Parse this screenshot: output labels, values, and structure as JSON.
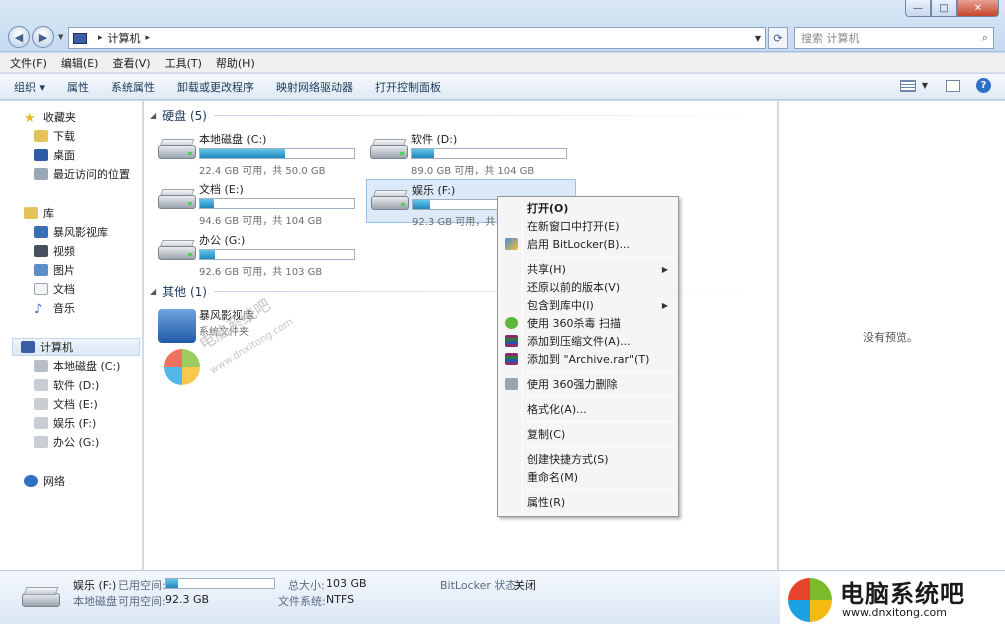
{
  "window": {
    "minimize": "—",
    "maximize": "□",
    "close": "✕"
  },
  "address": {
    "crumb": "计算机",
    "search_placeholder": "搜索 计算机"
  },
  "menubar": [
    "文件(F)",
    "编辑(E)",
    "查看(V)",
    "工具(T)",
    "帮助(H)"
  ],
  "toolbar": [
    "组织 ▾",
    "属性",
    "系统属性",
    "卸载或更改程序",
    "映射网络驱动器",
    "打开控制面板"
  ],
  "nav": {
    "favorites": "收藏夹",
    "downloads": "下载",
    "desktop": "桌面",
    "recent": "最近访问的位置",
    "libraries": "库",
    "storm": "暴风影视库",
    "videos": "视频",
    "pictures": "图片",
    "documents": "文档",
    "music": "音乐",
    "computer": "计算机",
    "drive_c": "本地磁盘 (C:)",
    "drive_d": "软件 (D:)",
    "drive_e": "文档 (E:)",
    "drive_f": "娱乐 (F:)",
    "drive_g": "办公 (G:)",
    "network": "网络"
  },
  "groups": {
    "hdd": "硬盘 (5)",
    "other": "其他 (1)"
  },
  "drives": [
    {
      "name": "本地磁盘 (C:)",
      "stat": "22.4 GB 可用，共 50.0 GB",
      "used_fraction": 0.55
    },
    {
      "name": "软件 (D:)",
      "stat": "89.0 GB 可用，共 104 GB",
      "used_fraction": 0.14
    },
    {
      "name": "文档 (E:)",
      "stat": "94.6 GB 可用，共 104 GB",
      "used_fraction": 0.09
    },
    {
      "name": "娱乐 (F:)",
      "stat": "92.3 GB 可用，共",
      "used_fraction": 0.11
    },
    {
      "name": "办公 (G:)",
      "stat": "92.6 GB 可用，共 103 GB",
      "used_fraction": 0.1
    }
  ],
  "other_item": {
    "name": "暴风影视库",
    "sub": "系统文件夹"
  },
  "watermark": {
    "text1": "电脑系统吧",
    "text2": "www.dnxitong.com"
  },
  "preview_text": "没有预览。",
  "context_menu": [
    "打开(O)",
    "在新窗口中打开(E)",
    "启用 BitLocker(B)...",
    "共享(H)",
    "还原以前的版本(V)",
    "包含到库中(I)",
    "使用 360杀毒 扫描",
    "添加到压缩文件(A)...",
    "添加到 \"Archive.rar\"(T)",
    "使用 360强力删除",
    "格式化(A)...",
    "复制(C)",
    "创建快捷方式(S)",
    "重命名(M)",
    "属性(R)"
  ],
  "details": {
    "name": "娱乐 (F:)",
    "used_label": "已用空间:",
    "type": "本地磁盘",
    "free_label": "可用空间:",
    "free_value": "92.3 GB",
    "total_label": "总大小:",
    "total_value": "103 GB",
    "fs_label": "文件系统:",
    "fs_value": "NTFS",
    "bitlocker_label": "BitLocker 状态:",
    "bitlocker_value": "关闭",
    "used_fraction": 0.11
  },
  "brand": {
    "title": "电脑系统吧",
    "url": "www.dnxitong.com"
  }
}
